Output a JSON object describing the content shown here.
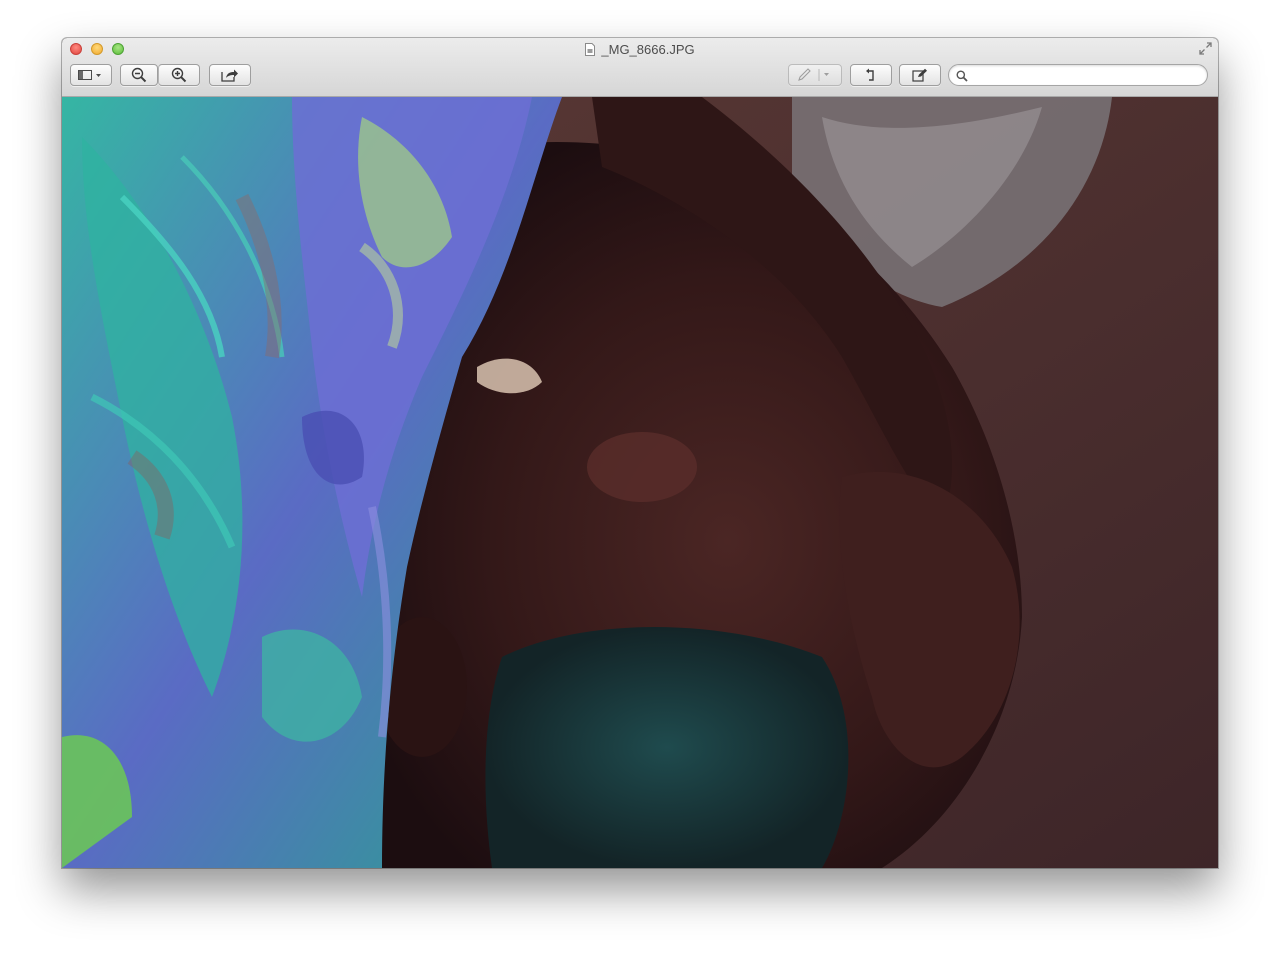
{
  "window": {
    "title": "_MG_8666.JPG",
    "file_icon": "document-icon"
  },
  "toolbar": {
    "buttons": [
      {
        "name": "sidebar-view-button",
        "icon": "sidebar-dropdown-icon"
      },
      {
        "name": "zoom-out-button",
        "icon": "zoom-out-icon"
      },
      {
        "name": "zoom-in-button",
        "icon": "zoom-in-icon"
      },
      {
        "name": "share-button",
        "icon": "share-icon"
      },
      {
        "name": "markup-button",
        "icon": "pencil-icon",
        "enabled": false
      },
      {
        "name": "rotate-button",
        "icon": "rotate-icon"
      },
      {
        "name": "edit-button",
        "icon": "edit-toolbar-icon"
      }
    ],
    "search": {
      "placeholder": "",
      "value": "",
      "icon": "magnifier-icon"
    }
  },
  "content": {
    "image": "photo",
    "colors": {
      "accent_teal": "#2aa89a",
      "accent_purple": "#6f6fd1",
      "skin": "#3a1c1c"
    }
  }
}
